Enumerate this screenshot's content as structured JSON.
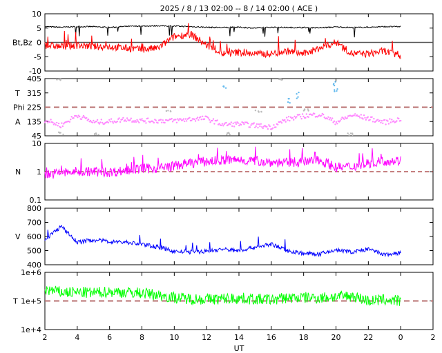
{
  "chart_data": {
    "type": "line",
    "title": "2025 /  8 / 13   02:00 --  8 / 14   02:00 ( ACE )",
    "xlabel": "UT",
    "x_range_hours": [
      0,
      24
    ],
    "x_tick_labels": [
      "2",
      "4",
      "6",
      "8",
      "10",
      "12",
      "14",
      "16",
      "18",
      "20",
      "22",
      "0",
      "2"
    ],
    "data_hours_offset": [
      0,
      1,
      2,
      3,
      4,
      5,
      6,
      7,
      8,
      9,
      10,
      11,
      12,
      13,
      14,
      15,
      16,
      17,
      18,
      19,
      20,
      21,
      22
    ],
    "panels": [
      {
        "id": "mag",
        "ylabel": "Bt,Bz",
        "scale": "linear",
        "ylim": [
          -10,
          10
        ],
        "y_ticks": [
          "10",
          "5",
          "0",
          "-5",
          "-10"
        ],
        "y_tick_values": [
          10,
          5,
          0,
          -5,
          -10
        ],
        "reference_line": 0,
        "series": [
          {
            "name": "Bt",
            "color": "#000000",
            "values": [
              5.5,
              5.3,
              5.5,
              5.5,
              5.2,
              5.6,
              5.7,
              5.8,
              5.7,
              5.5,
              5.3,
              5.2,
              5.3,
              5.0,
              5.3,
              5.2,
              5.2,
              5.1,
              5.4,
              5.2,
              5.3,
              5.5,
              5.5
            ]
          },
          {
            "name": "Bz",
            "color": "#ff0000",
            "values": [
              -1,
              -1.5,
              -1,
              -1.5,
              -1.5,
              -2,
              -2.5,
              -2,
              2,
              3,
              -1,
              -4,
              -3.5,
              -4,
              -4,
              -3,
              -4,
              -2,
              0,
              -4,
              -4,
              -3,
              -5
            ]
          }
        ]
      },
      {
        "id": "phi",
        "ylabel_lines": [
          "T",
          "Phi",
          "A"
        ],
        "scale": "linear",
        "ylim": [
          45,
          405
        ],
        "y_ticks": [
          "405",
          "315",
          "225",
          "135",
          "45"
        ],
        "y_tick_values": [
          405,
          315,
          225,
          135,
          45
        ],
        "reference_line": 225,
        "series": [
          {
            "name": "Phi",
            "color": "#ff88ff",
            "values": [
              145,
              110,
              175,
              130,
              135,
              150,
              140,
              140,
              140,
              150,
              155,
              115,
              120,
              110,
              100,
              150,
              170,
              180,
              130,
              175,
              155,
              130,
              150
            ]
          },
          {
            "name": "Phi-gray",
            "color": "#bbbbbb",
            "values": [
              60,
              55,
              400,
              200,
              60,
              400,
              200,
              210,
              55
            ]
          },
          {
            "name": "Phi-blue",
            "color": "#66bbee",
            "values": [
              340,
              300,
              260,
              380,
              320
            ]
          }
        ]
      },
      {
        "id": "density",
        "ylabel": "N",
        "scale": "log",
        "ylim": [
          0.1,
          10
        ],
        "y_ticks": [
          "10",
          "1",
          "0.1"
        ],
        "y_tick_values": [
          10,
          1,
          0.1
        ],
        "reference_line": 1,
        "series": [
          {
            "name": "N",
            "color": "#ff00ff",
            "values": [
              0.8,
              0.9,
              1.0,
              1.0,
              0.95,
              1.1,
              1.3,
              1.3,
              1.6,
              2.0,
              2.3,
              2.5,
              2.6,
              2.4,
              2.2,
              2.0,
              2.2,
              2.5,
              1.4,
              1.5,
              2.0,
              2.4,
              2.5
            ]
          }
        ]
      },
      {
        "id": "speed",
        "ylabel": "V",
        "scale": "linear",
        "ylim": [
          400,
          800
        ],
        "y_ticks": [
          "800",
          "700",
          "600",
          "500",
          "400"
        ],
        "y_tick_values": [
          800,
          700,
          600,
          500,
          400
        ],
        "series": [
          {
            "name": "V",
            "color": "#0000ff",
            "values": [
              580,
              670,
              560,
              575,
              565,
              560,
              545,
              525,
              495,
              490,
              495,
              510,
              500,
              525,
              545,
              500,
              480,
              475,
              505,
              490,
              510,
              470,
              485
            ]
          }
        ]
      },
      {
        "id": "temperature",
        "ylabel": "T",
        "scale": "log",
        "ylim": [
          10000,
          1000000
        ],
        "y_ticks": [
          "1e+6",
          "1e+5",
          "1e+4"
        ],
        "y_tick_values": [
          1000000,
          100000,
          10000
        ],
        "reference_line": 100000,
        "series": [
          {
            "name": "T",
            "color": "#00ff00",
            "values": [
              250000,
              200000,
              200000,
              190000,
              210000,
              200000,
              190000,
              160000,
              130000,
              120000,
              115000,
              120000,
              125000,
              115000,
              110000,
              130000,
              130000,
              130000,
              140000,
              150000,
              100000,
              110000,
              100000
            ]
          }
        ]
      }
    ]
  }
}
